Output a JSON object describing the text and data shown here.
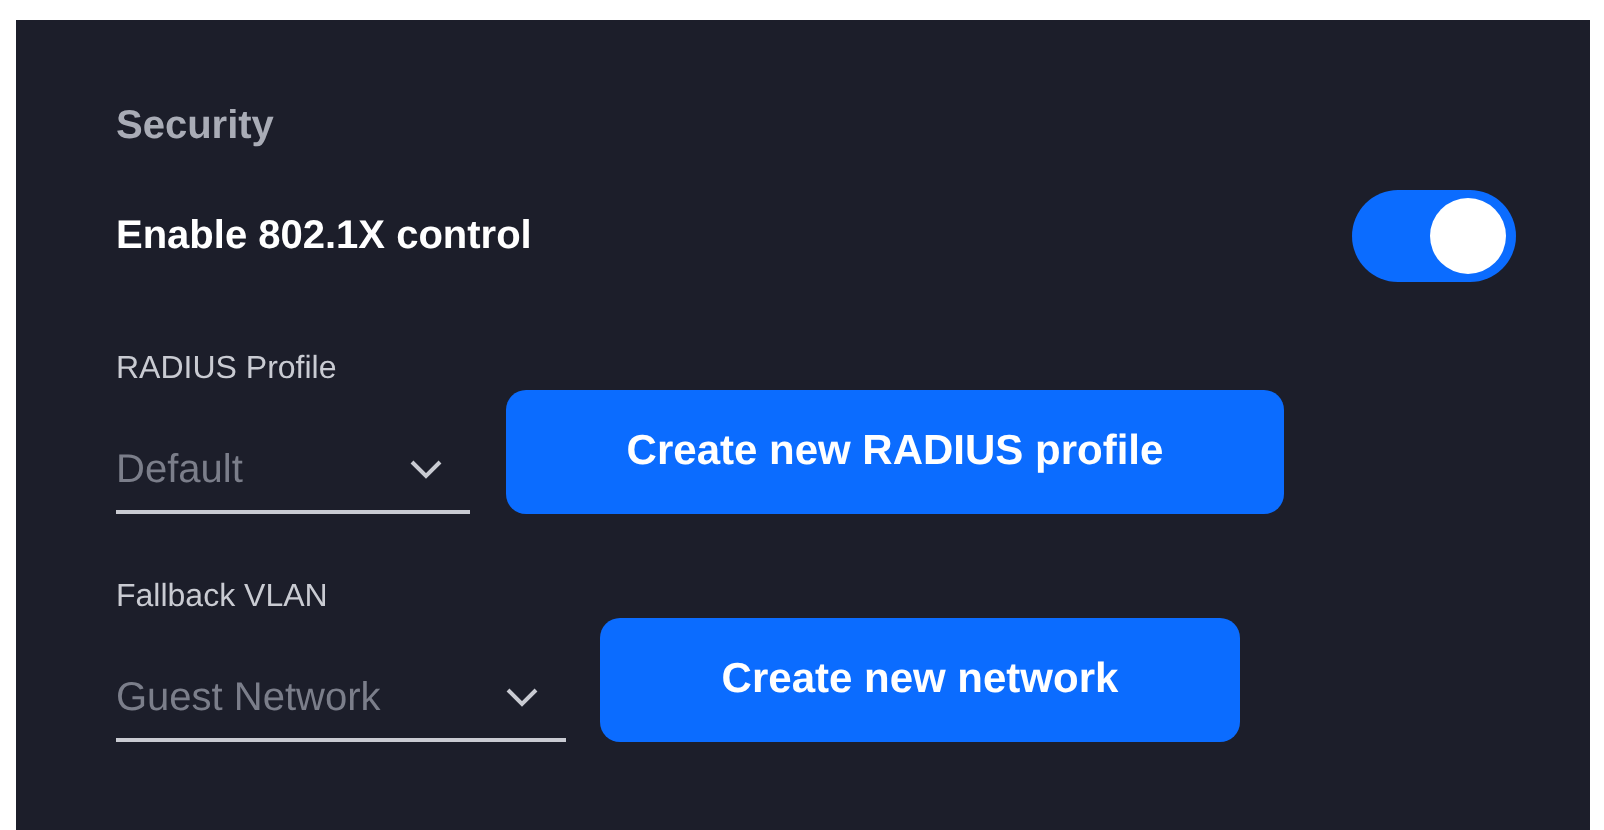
{
  "section": {
    "title": "Security"
  },
  "enable": {
    "label": "Enable 802.1X control",
    "on": true
  },
  "fields": [
    {
      "label": "RADIUS Profile",
      "value": "Default",
      "button": "Create new RADIUS profile"
    },
    {
      "label": "Fallback VLAN",
      "value": "Guest Network",
      "button": "Create new network"
    }
  ]
}
